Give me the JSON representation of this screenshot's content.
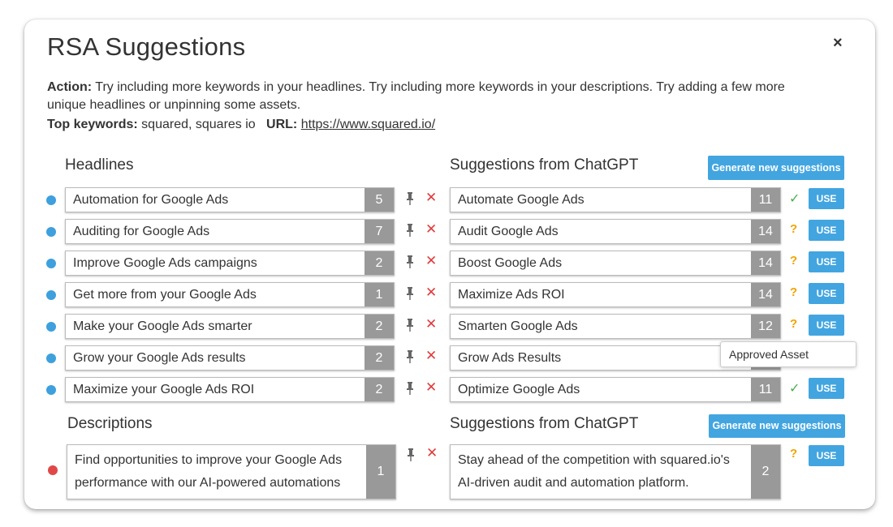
{
  "modal": {
    "title": "RSA Suggestions",
    "close": "×",
    "action_label": "Action:",
    "action_text": " Try including more keywords in your headlines. Try including more keywords in your descriptions. Try adding a few more unique headlines or unpinning some assets.",
    "keywords_label": "Top keywords:",
    "keywords_value": " squared, squares io",
    "url_label": "URL:",
    "url_value": "https://www.squared.io/"
  },
  "headlines": {
    "title": "Headlines",
    "items": [
      {
        "text": "Automation for Google Ads",
        "count": "5"
      },
      {
        "text": "Auditing for Google Ads",
        "count": "7"
      },
      {
        "text": "Improve Google Ads campaigns",
        "count": "2"
      },
      {
        "text": "Get more from your Google Ads",
        "count": "1"
      },
      {
        "text": "Make your Google Ads smarter",
        "count": "2"
      },
      {
        "text": "Grow your Google Ads results",
        "count": "2"
      },
      {
        "text": "Maximize your Google Ads ROI",
        "count": "2"
      }
    ]
  },
  "headline_suggestions": {
    "title": "Suggestions from ChatGPT",
    "generate_label": "Generate new suggestions",
    "items": [
      {
        "text": "Automate Google Ads",
        "count": "11",
        "status": "✓",
        "use": "USE"
      },
      {
        "text": "Audit Google Ads",
        "count": "14",
        "status": "?",
        "use": "USE"
      },
      {
        "text": "Boost Google Ads",
        "count": "14",
        "status": "?",
        "use": "USE"
      },
      {
        "text": "Maximize Ads ROI",
        "count": "14",
        "status": "?",
        "use": "USE"
      },
      {
        "text": "Smarten Google Ads",
        "count": "12",
        "status": "?",
        "use": "USE"
      },
      {
        "text": "Grow Ads Results",
        "count": "",
        "status": "",
        "use": ""
      },
      {
        "text": "Optimize Google Ads",
        "count": "11",
        "status": "✓",
        "use": "USE"
      }
    ],
    "tooltip": "Approved Asset"
  },
  "descriptions": {
    "title": "Descriptions",
    "items": [
      {
        "text": "Find opportunities to improve your Google Ads performance with our AI-powered automations",
        "count": "1"
      }
    ]
  },
  "description_suggestions": {
    "title": "Suggestions from ChatGPT",
    "generate_label": "Generate new suggestions",
    "items": [
      {
        "text": "Stay ahead of the competition with squared.io's AI-driven audit and automation platform.",
        "count": "2",
        "status": "?",
        "use": "USE"
      }
    ]
  },
  "colors": {
    "accent": "#42a5e0",
    "headline_dot": "#3ea0dc",
    "description_dot": "#e04848",
    "remove": "#e03c3c",
    "approved": "#4caf50",
    "pending": "#f0a500",
    "count_bg": "#999999"
  },
  "icons": {
    "pin": "pin-icon",
    "remove": "close-icon",
    "approved": "check-icon",
    "pending": "question-icon"
  }
}
